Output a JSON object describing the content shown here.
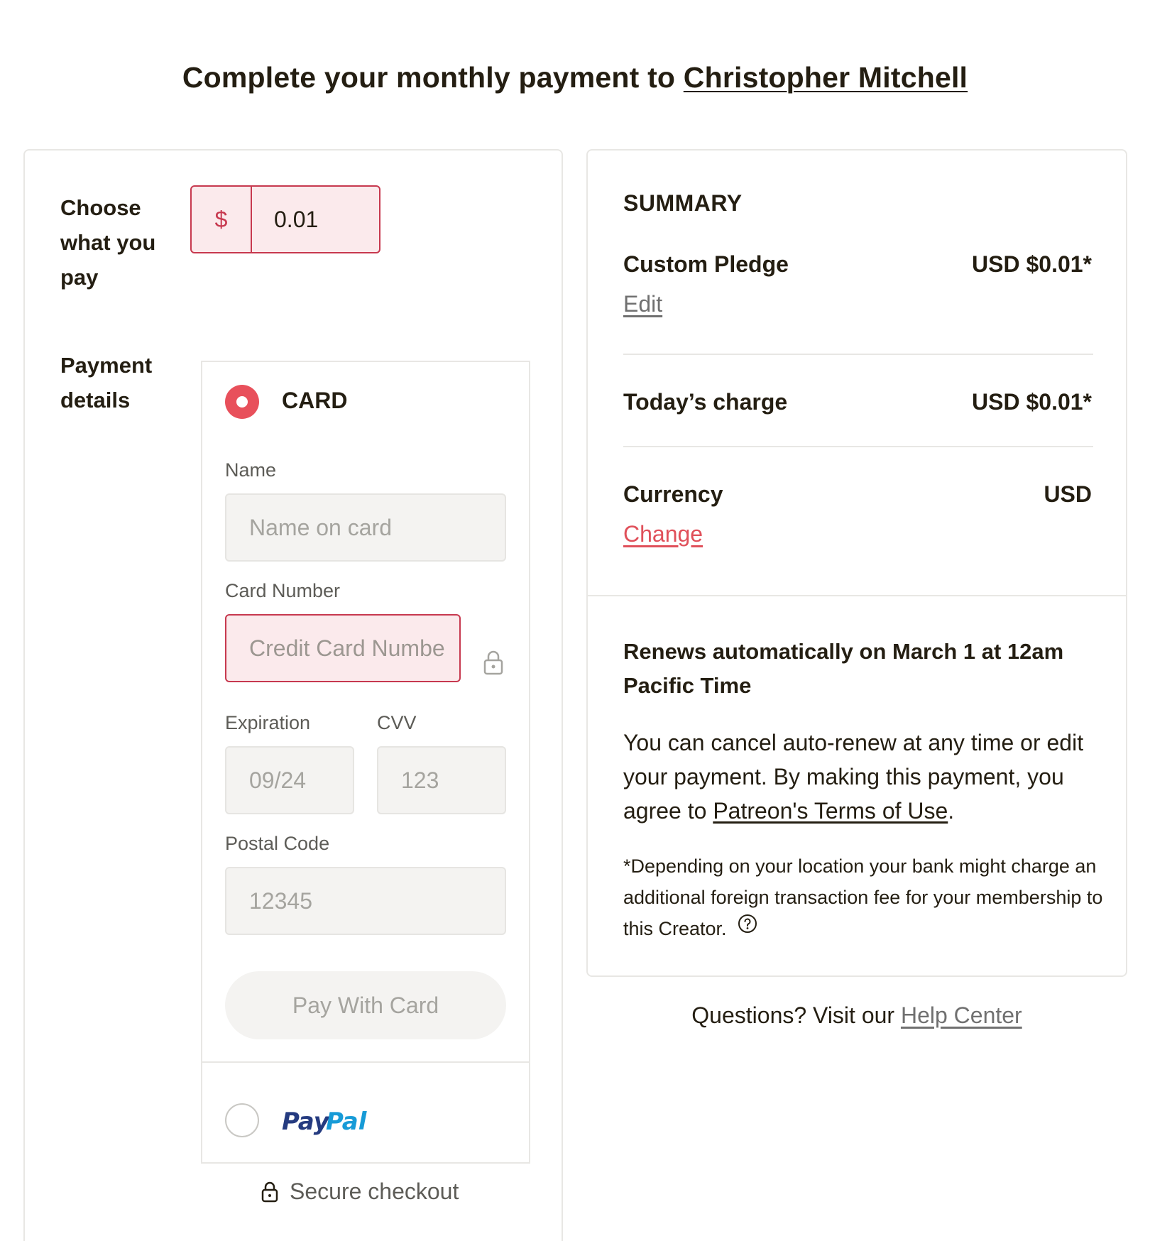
{
  "header": {
    "title_prefix": "Complete your monthly payment to",
    "creator_name": "Christopher Mitchell"
  },
  "amount": {
    "label": "Choose what you pay",
    "currency_symbol": "$",
    "value": "0.01"
  },
  "payment": {
    "section_label": "Payment details",
    "card_option_label": "CARD",
    "card_selected": true,
    "name_label": "Name",
    "name_placeholder": "Name on card",
    "card_number_label": "Card Number",
    "card_number_placeholder": "Credit Card Numbe",
    "expiration_label": "Expiration",
    "expiration_placeholder": "09/24",
    "cvv_label": "CVV",
    "cvv_placeholder": "123",
    "postal_label": "Postal Code",
    "postal_placeholder": "12345",
    "pay_button_label": "Pay With Card",
    "paypal_label": "PayPal",
    "paypal_selected": false,
    "secure_checkout_label": "Secure checkout"
  },
  "summary": {
    "title": "SUMMARY",
    "pledge_label": "Custom Pledge",
    "pledge_value": "USD $0.01*",
    "edit_link": "Edit",
    "today_label": "Today’s charge",
    "today_value": "USD $0.01*",
    "currency_label": "Currency",
    "currency_value": "USD",
    "change_link": "Change",
    "renew_title": "Renews automatically on March 1 at 12am Pacific Time",
    "renew_text_before": "You can cancel auto-renew at any time or edit your payment. By making this payment, you agree to",
    "terms_link": "Patreon's Terms of Use",
    "renew_text_after": ".",
    "fee_note": "*Depending on your location your bank might charge an additional foreign transaction fee for your membership to this Creator."
  },
  "help": {
    "prefix": "Questions? Visit our",
    "link": "Help Center"
  },
  "colors": {
    "accent_red": "#e8505b",
    "error_red": "#c7394f",
    "paypal_dark": "#253b80",
    "paypal_light": "#179bd7"
  }
}
